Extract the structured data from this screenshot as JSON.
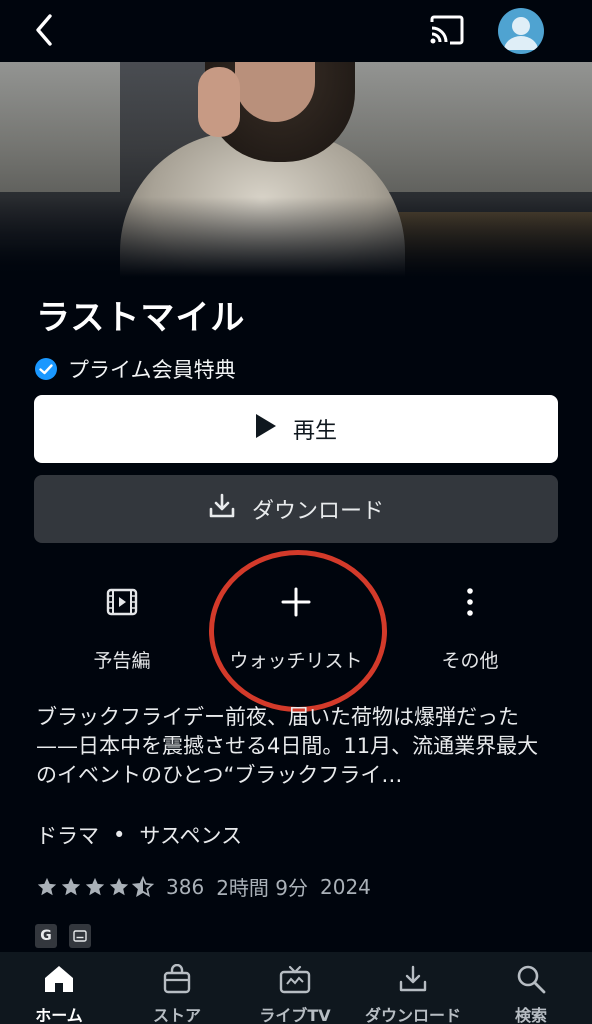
{
  "header": {
    "back_icon": "chevron-left-icon",
    "cast_icon": "cast-icon",
    "avatar_icon": "profile-avatar-icon"
  },
  "title": "ラストマイル",
  "prime_label": "プライム会員特典",
  "buttons": {
    "play": "再生",
    "download": "ダウンロード"
  },
  "actions": [
    {
      "label": "予告編",
      "icon": "trailer-icon"
    },
    {
      "label": "ウォッチリスト",
      "icon": "plus-icon"
    },
    {
      "label": "その他",
      "icon": "more-vertical-icon"
    }
  ],
  "description": "ブラックフライデー前夜、届いた荷物は爆弾だった——日本中を震撼させる4日間。11月、流通業界最大のイベントのひとつ“ブラックフライ…",
  "genres": {
    "first": "ドラマ",
    "separator": "•",
    "second": "サスペンス"
  },
  "meta": {
    "rating_stars": 4.5,
    "rating_count": "386",
    "duration": "2時間 9分",
    "year": "2024"
  },
  "badges": {
    "age": "G"
  },
  "nav": [
    {
      "label": "ホーム",
      "icon": "home-icon",
      "active": true
    },
    {
      "label": "ストア",
      "icon": "store-bag-icon",
      "active": false
    },
    {
      "label": "ライブTV",
      "icon": "live-tv-icon",
      "active": false
    },
    {
      "label": "ダウンロード",
      "icon": "download-icon",
      "active": false
    },
    {
      "label": "検索",
      "icon": "search-icon",
      "active": false
    }
  ],
  "colors": {
    "background": "#00050d",
    "accent_blue": "#1a98ff",
    "annotation_red": "#d33a2a"
  }
}
